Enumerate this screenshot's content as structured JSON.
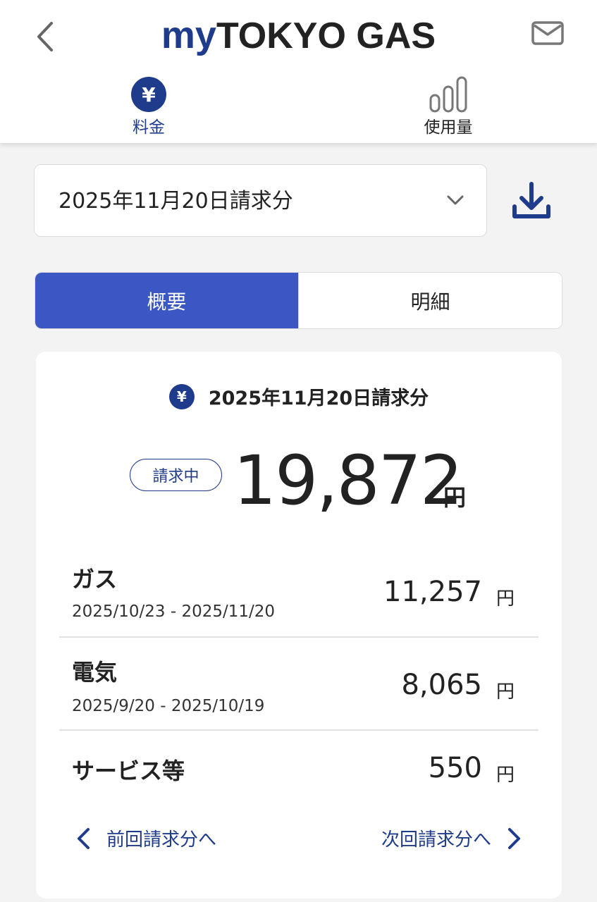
{
  "header": {
    "logo_my": "my",
    "logo_rest": "TOKYO GAS",
    "nav": [
      {
        "label": "料金",
        "icon": "yen-icon",
        "active": true
      },
      {
        "label": "使用量",
        "icon": "bar-chart-icon",
        "active": false
      }
    ]
  },
  "billing_select": {
    "value": "2025年11月20日請求分"
  },
  "segments": {
    "summary": "概要",
    "details": "明細"
  },
  "card": {
    "title": "2025年11月20日請求分",
    "status": "請求中",
    "total": "19,872",
    "currency": "円",
    "items": [
      {
        "name": "ガス",
        "period": "2025/10/23 - 2025/11/20",
        "amount": "11,257",
        "unit": "円"
      },
      {
        "name": "電気",
        "period": "2025/9/20 - 2025/10/19",
        "amount": "8,065",
        "unit": "円"
      },
      {
        "name": "サービス等",
        "period": "",
        "amount": "550",
        "unit": "円"
      }
    ],
    "prev_label": "前回請求分へ",
    "next_label": "次回請求分へ"
  },
  "colors": {
    "brand": "#1f3b8c",
    "segment_active": "#3a57c4"
  }
}
